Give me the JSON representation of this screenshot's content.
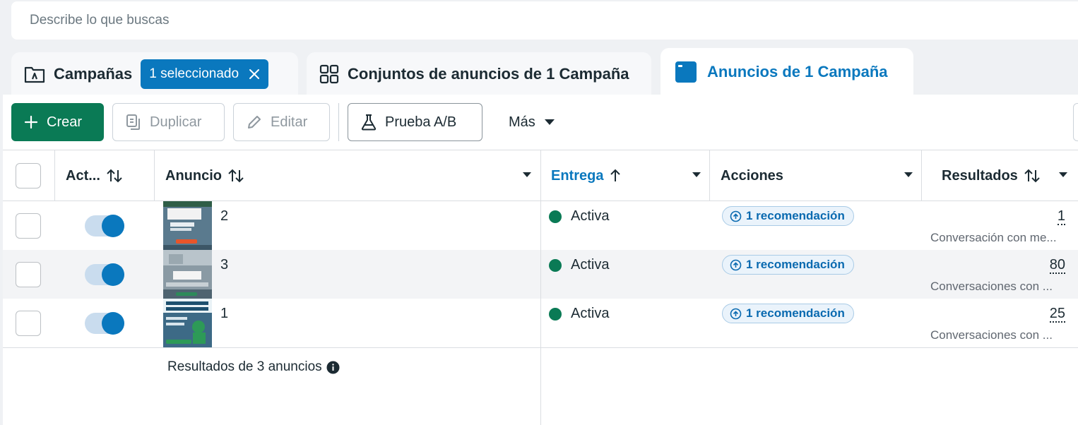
{
  "search": {
    "placeholder": "Describe lo que buscas"
  },
  "tabs": {
    "campaigns": {
      "label": "Campañas",
      "selected_label": "1 seleccionado"
    },
    "adsets": {
      "label": "Conjuntos de anuncios de 1 Campaña"
    },
    "ads": {
      "label": "Anuncios de 1 Campaña"
    }
  },
  "toolbar": {
    "create_label": "Crear",
    "duplicate_label": "Duplicar",
    "edit_label": "Editar",
    "ab_test_label": "Prueba A/B",
    "more_label": "Más"
  },
  "columns": {
    "active": "Act...",
    "ad": "Anuncio",
    "delivery": "Entrega",
    "actions": "Acciones",
    "results": "Resultados"
  },
  "rows": [
    {
      "name": "2",
      "status": "Activa",
      "recommendation": "1 recomendación",
      "result": "1",
      "result_type": "Conversación con me...",
      "active": true
    },
    {
      "name": "3",
      "status": "Activa",
      "recommendation": "1 recomendación",
      "result": "80",
      "result_type": "Conversaciones con ...",
      "active": true
    },
    {
      "name": "1",
      "status": "Activa",
      "recommendation": "1 recomendación",
      "result": "25",
      "result_type": "Conversaciones con ...",
      "active": true
    }
  ],
  "footer": {
    "summary": "Resultados de 3 anuncios"
  },
  "colors": {
    "accent": "#0a78be",
    "primary_button": "#0a7a55",
    "status_active": "#0a7a55"
  }
}
